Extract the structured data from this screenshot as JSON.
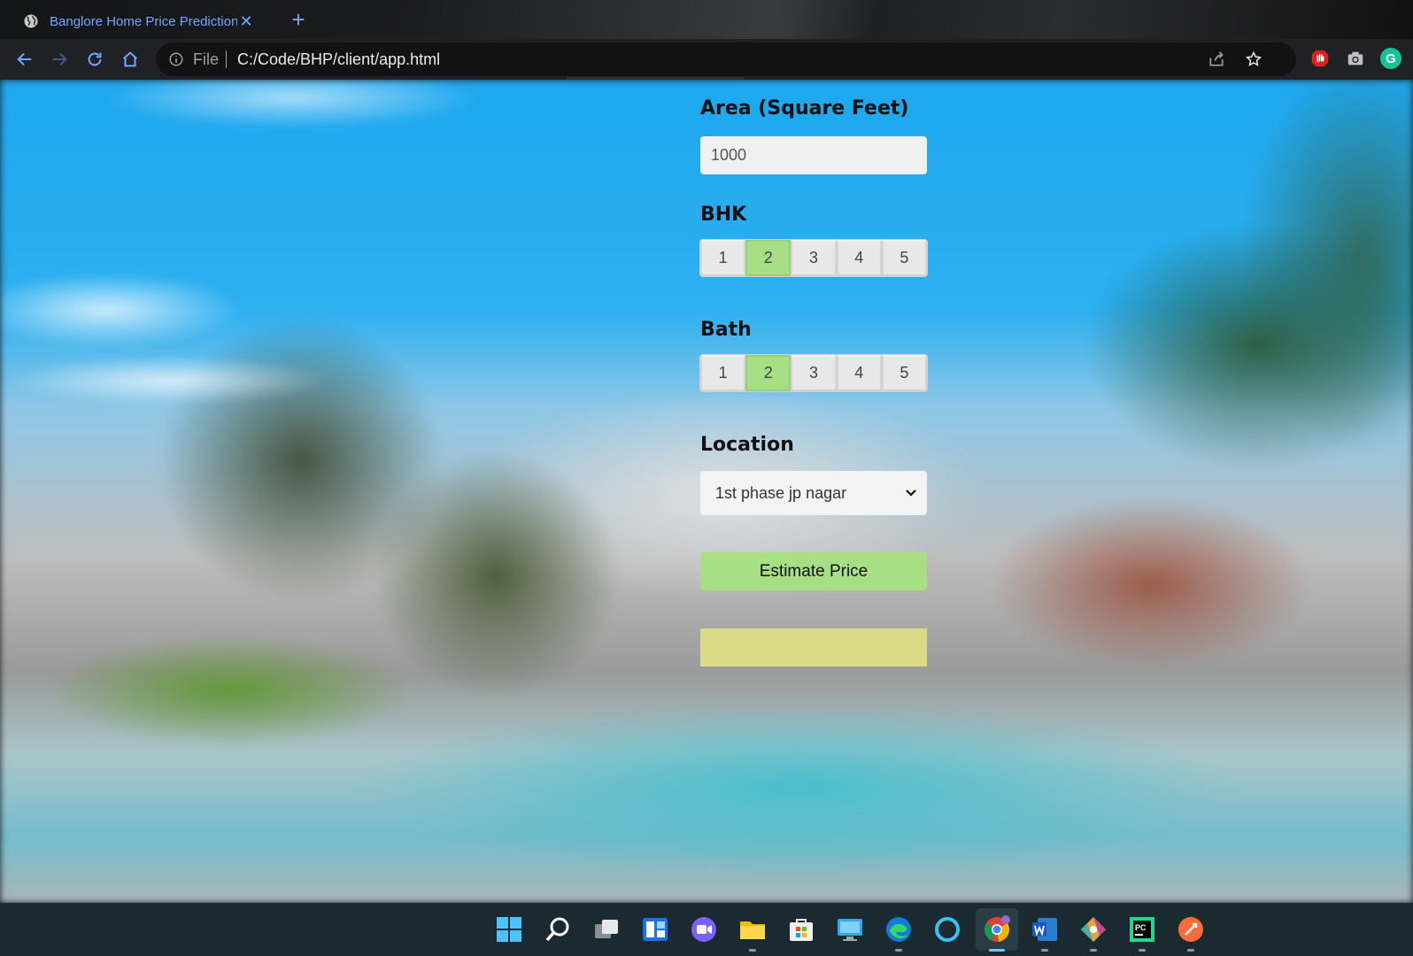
{
  "browser": {
    "tab_title": "Banglore Home Price Prediction",
    "omnibox_scheme": "File",
    "url": "C:/Code/BHP/client/app.html"
  },
  "form": {
    "area": {
      "label": "Area (Square Feet)",
      "value": "1000"
    },
    "bhk": {
      "label": "BHK",
      "options": [
        "1",
        "2",
        "3",
        "4",
        "5"
      ],
      "selected": "2"
    },
    "bath": {
      "label": "Bath",
      "options": [
        "1",
        "2",
        "3",
        "4",
        "5"
      ],
      "selected": "2"
    },
    "location": {
      "label": "Location",
      "selected": "1st phase jp nagar"
    },
    "estimate_button": "Estimate Price",
    "result": ""
  },
  "colors": {
    "accent_green": "#a6df84",
    "result_yellow": "#dcd987",
    "tab_blue": "#6ea9ff"
  },
  "taskbar": {
    "icons": [
      "windows-start-icon",
      "search-icon",
      "task-view-icon",
      "widgets-icon",
      "teams-chat-icon",
      "file-explorer-icon",
      "microsoft-store-icon",
      "remote-desktop-icon",
      "edge-icon",
      "cortana-icon",
      "chrome-icon",
      "word-icon",
      "git-icon",
      "pycharm-icon",
      "postman-icon"
    ]
  }
}
